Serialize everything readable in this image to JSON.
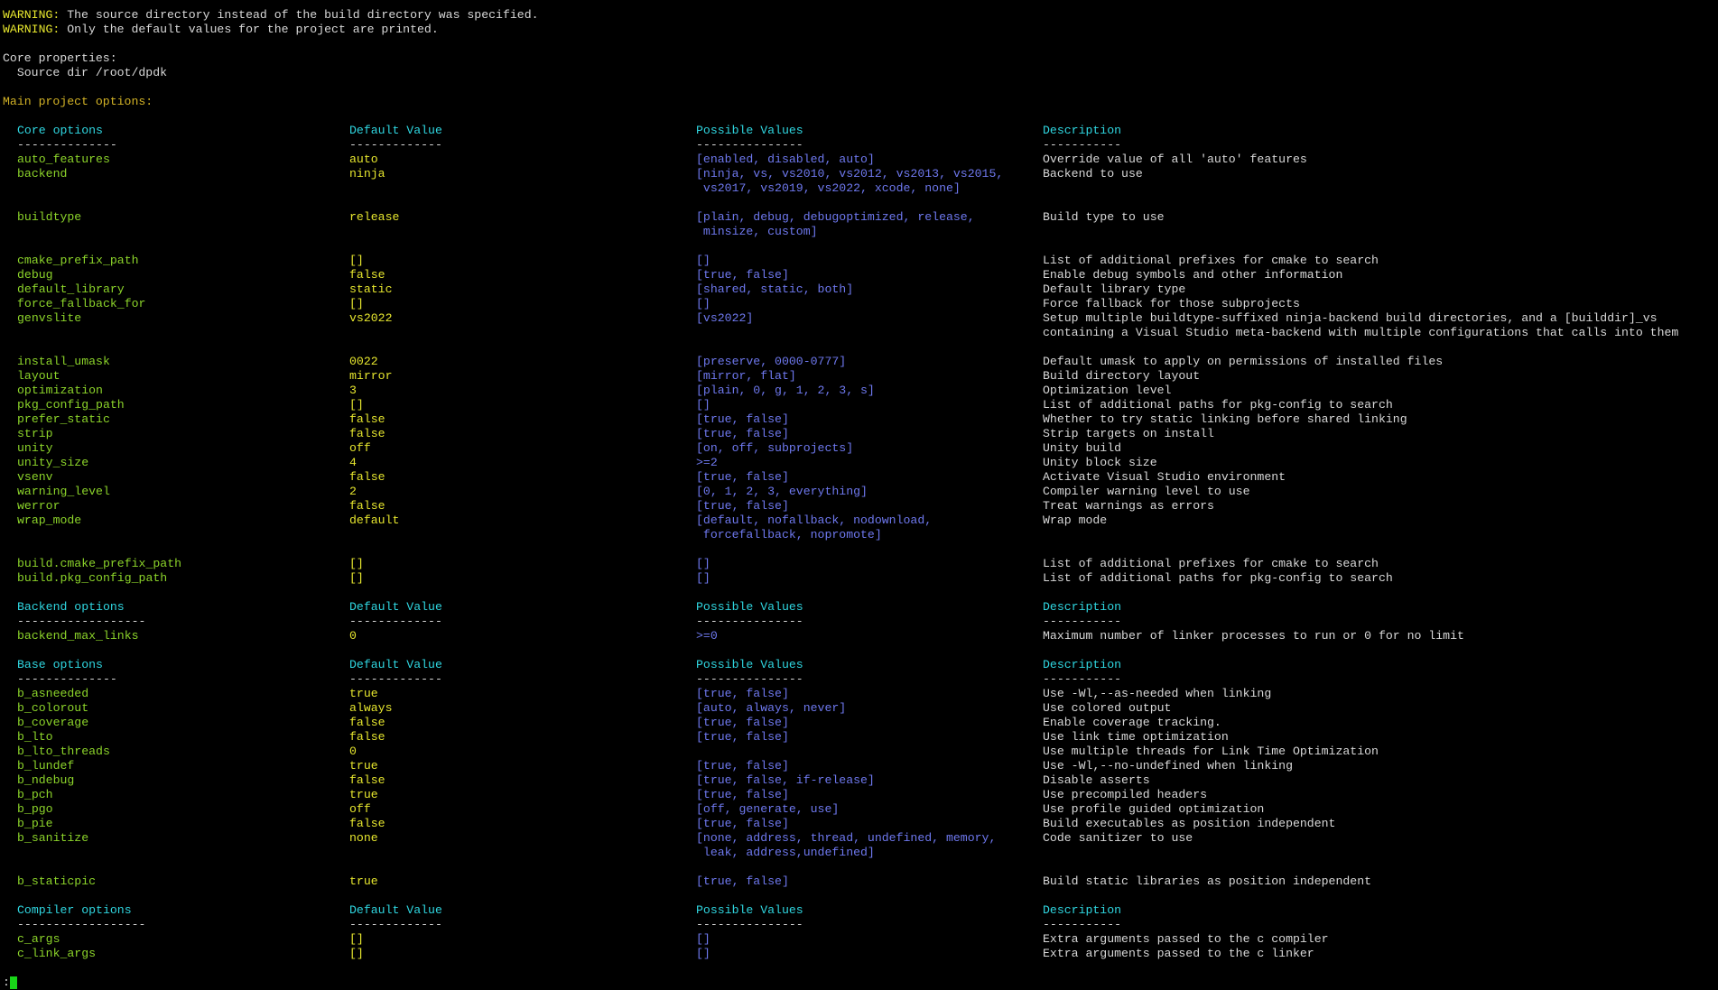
{
  "warnings": [
    {
      "label": "WARNING:",
      "text": " The source directory instead of the build directory was specified."
    },
    {
      "label": "WARNING:",
      "text": " Only the default values for the project are printed."
    }
  ],
  "core_properties": {
    "title": "Core properties:",
    "source_dir": "  Source dir /root/dpdk"
  },
  "main_title": "Main project options:",
  "columns": {
    "default": "Default Value",
    "possible": "Possible Values",
    "description": "Description",
    "default_sep": "-------------",
    "possible_sep": "---------------",
    "description_sep": "-----------"
  },
  "sections": [
    {
      "title": "Core options",
      "sep": "--------------",
      "rows": [
        {
          "name": "auto_features",
          "value": "auto",
          "possible": [
            "[enabled, disabled, auto]"
          ],
          "desc": [
            "Override value of all 'auto' features"
          ]
        },
        {
          "name": "backend",
          "value": "ninja",
          "possible": [
            "[ninja, vs, vs2010, vs2012, vs2013, vs2015,",
            " vs2017, vs2019, vs2022, xcode, none]"
          ],
          "desc": [
            "Backend to use"
          ]
        },
        {
          "name": "buildtype",
          "value": "release",
          "possible": [
            "[plain, debug, debugoptimized, release,",
            " minsize, custom]"
          ],
          "desc": [
            "Build type to use"
          ]
        },
        {
          "name": "cmake_prefix_path",
          "value": "[]",
          "possible": [
            "[]"
          ],
          "desc": [
            "List of additional prefixes for cmake to search"
          ]
        },
        {
          "name": "debug",
          "value": "false",
          "possible": [
            "[true, false]"
          ],
          "desc": [
            "Enable debug symbols and other information"
          ]
        },
        {
          "name": "default_library",
          "value": "static",
          "possible": [
            "[shared, static, both]"
          ],
          "desc": [
            "Default library type"
          ]
        },
        {
          "name": "force_fallback_for",
          "value": "[]",
          "possible": [
            "[]"
          ],
          "desc": [
            "Force fallback for those subprojects"
          ]
        },
        {
          "name": "genvslite",
          "value": "vs2022",
          "possible": [
            "[vs2022]"
          ],
          "desc": [
            "Setup multiple buildtype-suffixed ninja-backend build directories, and a [builddir]_vs",
            "containing a Visual Studio meta-backend with multiple configurations that calls into them"
          ]
        },
        {
          "name": "install_umask",
          "value": "0022",
          "possible": [
            "[preserve, 0000-0777]"
          ],
          "desc": [
            "Default umask to apply on permissions of installed files"
          ]
        },
        {
          "name": "layout",
          "value": "mirror",
          "possible": [
            "[mirror, flat]"
          ],
          "desc": [
            "Build directory layout"
          ]
        },
        {
          "name": "optimization",
          "value": "3",
          "possible": [
            "[plain, 0, g, 1, 2, 3, s]"
          ],
          "desc": [
            "Optimization level"
          ]
        },
        {
          "name": "pkg_config_path",
          "value": "[]",
          "possible": [
            "[]"
          ],
          "desc": [
            "List of additional paths for pkg-config to search"
          ]
        },
        {
          "name": "prefer_static",
          "value": "false",
          "possible": [
            "[true, false]"
          ],
          "desc": [
            "Whether to try static linking before shared linking"
          ]
        },
        {
          "name": "strip",
          "value": "false",
          "possible": [
            "[true, false]"
          ],
          "desc": [
            "Strip targets on install"
          ]
        },
        {
          "name": "unity",
          "value": "off",
          "possible": [
            "[on, off, subprojects]"
          ],
          "desc": [
            "Unity build"
          ]
        },
        {
          "name": "unity_size",
          "value": "4",
          "possible": [
            ">=2"
          ],
          "desc": [
            "Unity block size"
          ]
        },
        {
          "name": "vsenv",
          "value": "false",
          "possible": [
            "[true, false]"
          ],
          "desc": [
            "Activate Visual Studio environment"
          ]
        },
        {
          "name": "warning_level",
          "value": "2",
          "possible": [
            "[0, 1, 2, 3, everything]"
          ],
          "desc": [
            "Compiler warning level to use"
          ]
        },
        {
          "name": "werror",
          "value": "false",
          "possible": [
            "[true, false]"
          ],
          "desc": [
            "Treat warnings as errors"
          ]
        },
        {
          "name": "wrap_mode",
          "value": "default",
          "possible": [
            "[default, nofallback, nodownload,",
            " forcefallback, nopromote]"
          ],
          "desc": [
            "Wrap mode"
          ]
        },
        {
          "name": "build.cmake_prefix_path",
          "value": "[]",
          "possible": [
            "[]"
          ],
          "desc": [
            "List of additional prefixes for cmake to search"
          ]
        },
        {
          "name": "build.pkg_config_path",
          "value": "[]",
          "possible": [
            "[]"
          ],
          "desc": [
            "List of additional paths for pkg-config to search"
          ]
        }
      ]
    },
    {
      "title": "Backend options",
      "sep": "------------------",
      "rows": [
        {
          "name": "backend_max_links",
          "value": "0",
          "possible": [
            ">=0"
          ],
          "desc": [
            "Maximum number of linker processes to run or 0 for no limit"
          ]
        }
      ]
    },
    {
      "title": "Base options",
      "sep": "--------------",
      "rows": [
        {
          "name": "b_asneeded",
          "value": "true",
          "possible": [
            "[true, false]"
          ],
          "desc": [
            "Use -Wl,--as-needed when linking"
          ]
        },
        {
          "name": "b_colorout",
          "value": "always",
          "possible": [
            "[auto, always, never]"
          ],
          "desc": [
            "Use colored output"
          ]
        },
        {
          "name": "b_coverage",
          "value": "false",
          "possible": [
            "[true, false]"
          ],
          "desc": [
            "Enable coverage tracking."
          ]
        },
        {
          "name": "b_lto",
          "value": "false",
          "possible": [
            "[true, false]"
          ],
          "desc": [
            "Use link time optimization"
          ]
        },
        {
          "name": "b_lto_threads",
          "value": "0",
          "possible": [
            ""
          ],
          "desc": [
            "Use multiple threads for Link Time Optimization"
          ]
        },
        {
          "name": "b_lundef",
          "value": "true",
          "possible": [
            "[true, false]"
          ],
          "desc": [
            "Use -Wl,--no-undefined when linking"
          ]
        },
        {
          "name": "b_ndebug",
          "value": "false",
          "possible": [
            "[true, false, if-release]"
          ],
          "desc": [
            "Disable asserts"
          ]
        },
        {
          "name": "b_pch",
          "value": "true",
          "possible": [
            "[true, false]"
          ],
          "desc": [
            "Use precompiled headers"
          ]
        },
        {
          "name": "b_pgo",
          "value": "off",
          "possible": [
            "[off, generate, use]"
          ],
          "desc": [
            "Use profile guided optimization"
          ]
        },
        {
          "name": "b_pie",
          "value": "false",
          "possible": [
            "[true, false]"
          ],
          "desc": [
            "Build executables as position independent"
          ]
        },
        {
          "name": "b_sanitize",
          "value": "none",
          "possible": [
            "[none, address, thread, undefined, memory,",
            " leak, address,undefined]"
          ],
          "desc": [
            "Code sanitizer to use"
          ]
        },
        {
          "name": "b_staticpic",
          "value": "true",
          "possible": [
            "[true, false]"
          ],
          "desc": [
            "Build static libraries as position independent"
          ]
        }
      ]
    },
    {
      "title": "Compiler options",
      "sep": "------------------",
      "rows": [
        {
          "name": "c_args",
          "value": "[]",
          "possible": [
            "[]"
          ],
          "desc": [
            "Extra arguments passed to the c compiler"
          ]
        },
        {
          "name": "c_link_args",
          "value": "[]",
          "possible": [
            "[]"
          ],
          "desc": [
            "Extra arguments passed to the c linker"
          ]
        }
      ]
    }
  ],
  "prompt": ":"
}
